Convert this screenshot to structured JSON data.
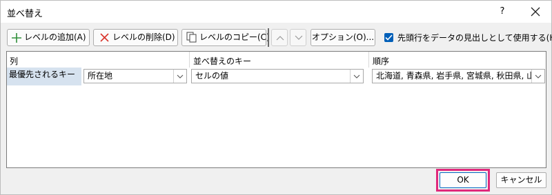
{
  "window": {
    "title": "並べ替え",
    "help_label": "?"
  },
  "toolbar": {
    "add_label": "レベルの追加(A)",
    "delete_label": "レベルの削除(D)",
    "copy_label": "レベルのコピー(C)",
    "options_label": "オプション(O)...",
    "header_checkbox_label": "先頭行をデータの見出しとして使用する(H)",
    "header_checkbox_checked": true
  },
  "table": {
    "headers": [
      "列",
      "並べ替えのキー",
      "順序"
    ],
    "rows": [
      {
        "label": "最優先されるキー",
        "column": "所在地",
        "sort_on": "セルの値",
        "order": "北海道, 青森県, 岩手県, 宮城県, 秋田県, 山形県"
      }
    ]
  },
  "footer": {
    "ok_label": "OK",
    "cancel_label": "キャンセル"
  },
  "colors": {
    "accent": "#005fb8",
    "highlight_frame": "#e0287c",
    "row_label_bg": "#d6e2ef",
    "add_icon": "#2f8f3a",
    "delete_icon": "#d9342b"
  }
}
